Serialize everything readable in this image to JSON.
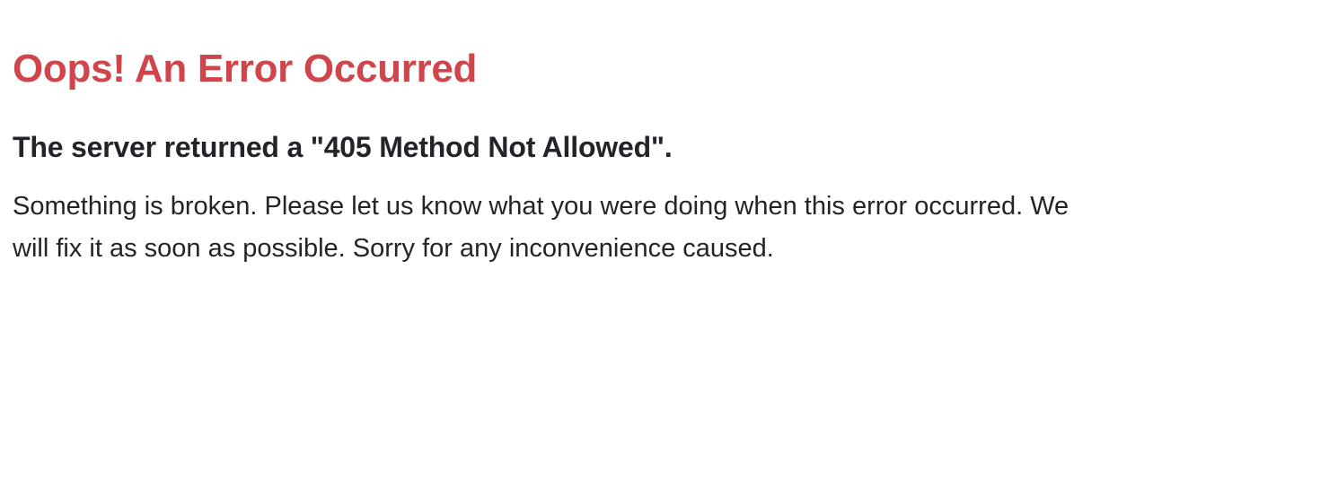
{
  "error": {
    "title": "Oops! An Error Occurred",
    "subtitle": "The server returned a \"405 Method Not Allowed\".",
    "message": "Something is broken. Please let us know what you were doing when this error occurred. We will fix it as soon as possible. Sorry for any inconvenience caused."
  },
  "colors": {
    "title": "#d0454c",
    "text": "#212529",
    "background": "#ffffff"
  }
}
